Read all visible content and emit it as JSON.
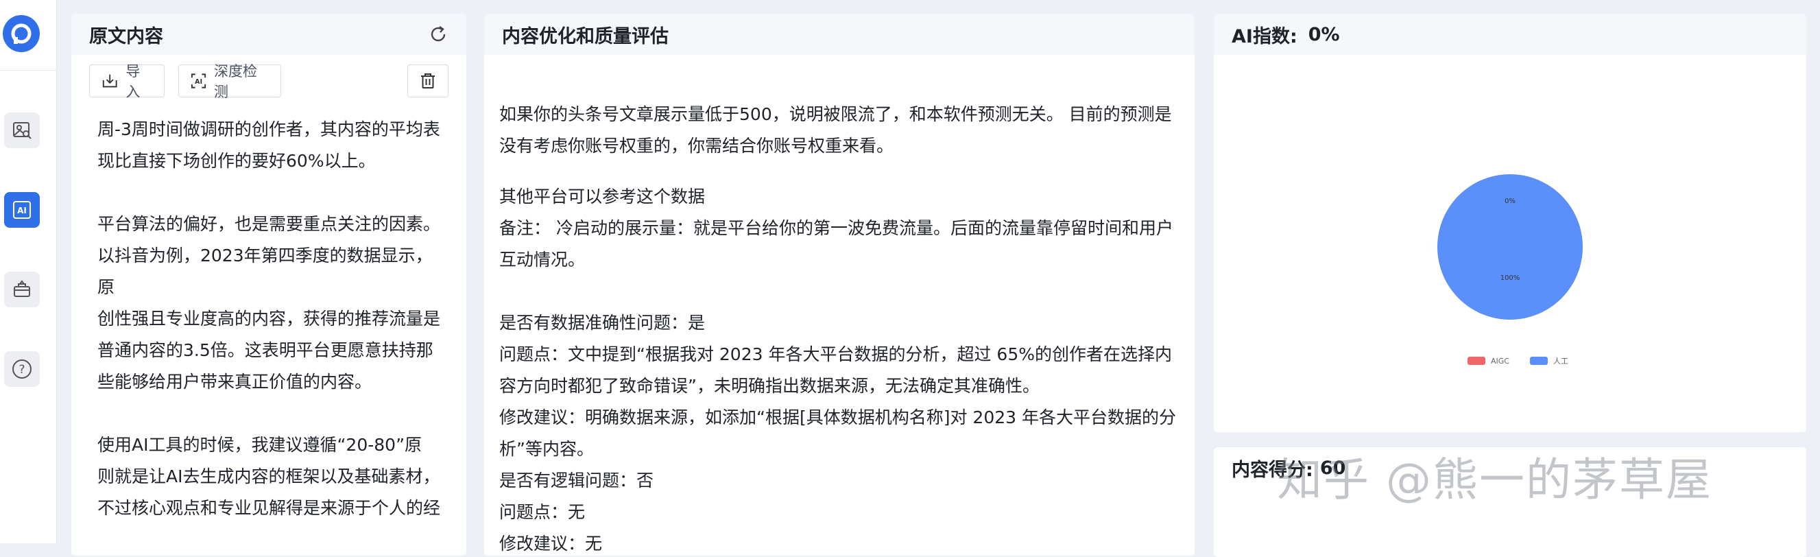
{
  "sidebar": {
    "logo_icon": "logo-icon",
    "items": [
      {
        "name": "image-analysis-icon",
        "active": false
      },
      {
        "name": "ai-icon",
        "active": true,
        "label": "AI"
      },
      {
        "name": "toolbox-icon",
        "active": false
      },
      {
        "name": "help-icon",
        "active": false,
        "label": "?"
      }
    ]
  },
  "original": {
    "title": "原文内容",
    "import_label": "导入",
    "deep_check_label": "深度检测",
    "paragraphs": [
      [
        "周-3周时间做调研的创作者，其内容的平均表",
        "现比直接下场创作的要好60%以上。"
      ],
      [
        "平台算法的偏好，也是需要重点关注的因素。",
        "以抖音为例，2023年第四季度的数据显示，原",
        "创性强且专业度高的内容，获得的推荐流量是",
        "普通内容的3.5倍。这表明平台更愿意扶持那",
        "些能够给用户带来真正价值的内容。"
      ],
      [
        "使用AI工具的时候，我建议遵循“20-80”原",
        "则就是让AI去生成内容的框架以及基础素材，",
        "不过核心观点和专业见解得是来源于个人的经"
      ]
    ]
  },
  "evaluation": {
    "title": "内容优化和质量评估",
    "lines": [
      "如果你的头条号文章展示量低于500，说明被限流了，和本软件预测无关。 目前的预测是",
      "没有考虑你账号权重的，你需结合你账号权重来看。",
      "",
      "其他平台可以参考这个数据",
      "备注： 冷启动的展示量：就是平台给你的第一波免费流量。后面的流量靠停留时间和用户",
      "互动情况。",
      "",
      "",
      "是否有数据准确性问题：是",
      "问题点：文中提到“根据我对 2023 年各大平台数据的分析，超过 65%的创作者在选择内",
      "容方向时都犯了致命错误”，未明确指出数据来源，无法确定其准确性。",
      "修改建议：明确数据来源，如添加“根据[具体数据机构名称]对 2023 年各大平台数据的分",
      "析”等内容。",
      "是否有逻辑问题：否",
      "问题点：无",
      "修改建议：无"
    ]
  },
  "ai_index": {
    "title": "AI指数:",
    "value": "0%"
  },
  "chart_data": {
    "type": "pie",
    "categories": [
      "AIGC",
      "人工"
    ],
    "values": [
      0,
      100
    ],
    "slice_labels": [
      "0%",
      "100%"
    ],
    "colors": [
      "#ee6666",
      "#5b8ff9"
    ],
    "legend": "bottom"
  },
  "content_score": {
    "title": "内容得分:",
    "value": "60"
  },
  "watermark": "知乎 @熊一的茅草屋",
  "colors": {
    "accent": "#2f6fe9",
    "pie_blue": "#5b8ff9",
    "pie_red": "#ee6666"
  }
}
